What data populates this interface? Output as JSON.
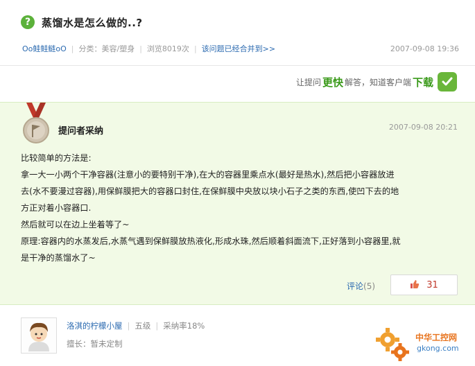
{
  "question": {
    "icon": "question-mark-icon",
    "icon_glyph": "?",
    "title": "蒸馏水是怎么做的..?",
    "author": "Oo鲑鲑鲢oO",
    "category": "分类：美容/塑身",
    "views": "浏览8019次",
    "merged_link": "该问题已经合并到>>",
    "time": "2007-09-08 19:36"
  },
  "promo": {
    "prefix": "让提问",
    "fast": "更快",
    "middle": "解答，知道客户端",
    "download": "下载"
  },
  "answer": {
    "badge_label": "提问者采纳",
    "time": "2007-09-08 20:21",
    "lines": [
      "比较简单的方法是:",
      "拿一大一小两个干净容器(注意小的要特别干净),在大的容器里乘点水(最好是热水),然后把小容器放进",
      "去(水不要漫过容器),用保鲜膜把大的容器口封住,在保鲜膜中央放以块小石子之类的东西,使凹下去的地",
      "方正对着小容器口.",
      "然后就可以在边上坐着等了~",
      "原理:容器内的水蒸发后,水蒸气遇到保鲜膜放热液化,形成水珠,然后顺着斜面流下,正好落到小容器里,就",
      "是干净的蒸馏水了~"
    ],
    "comment_label": "评论",
    "comment_count": "(5)",
    "like_count": "31"
  },
  "answerer": {
    "name": "洛淇的柠檬小屋",
    "level": "五级",
    "adopt_rate": "采纳率18%",
    "specialty": "擅长：暂未定制"
  },
  "watermark": {
    "cn": "中华工控网",
    "url": "gkong.com"
  },
  "colors": {
    "accent_green": "#5bb13a",
    "link_blue": "#2b6ab0",
    "answer_bg": "#f2fae6",
    "like_red": "#c0392b"
  }
}
